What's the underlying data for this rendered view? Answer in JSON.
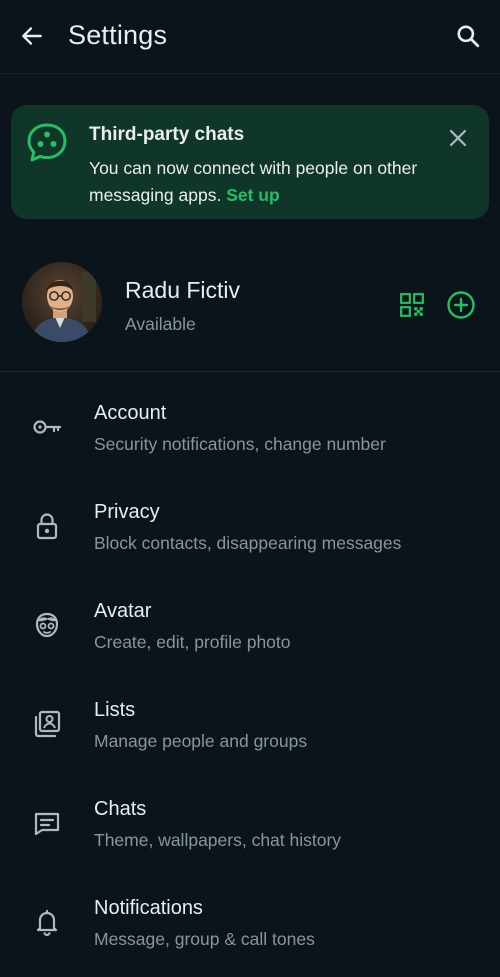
{
  "header": {
    "title": "Settings",
    "back_icon": "arrow-left-icon",
    "search_icon": "search-icon"
  },
  "banner": {
    "title": "Third-party chats",
    "text": "You can now connect with people on other messaging apps.",
    "link": "Set up",
    "icon": "chat-bubble-icon",
    "close_icon": "close-icon"
  },
  "profile": {
    "name": "Radu Fictiv",
    "status": "Available",
    "qr_icon": "qr-code-icon",
    "add_icon": "add-circle-icon"
  },
  "settings": {
    "items": [
      {
        "title": "Account",
        "subtitle": "Security notifications, change number",
        "icon": "key-icon"
      },
      {
        "title": "Privacy",
        "subtitle": "Block contacts, disappearing messages",
        "icon": "lock-icon"
      },
      {
        "title": "Avatar",
        "subtitle": "Create, edit, profile photo",
        "icon": "avatar-face-icon"
      },
      {
        "title": "Lists",
        "subtitle": "Manage people and groups",
        "icon": "contacts-list-icon"
      },
      {
        "title": "Chats",
        "subtitle": "Theme, wallpapers, chat history",
        "icon": "chat-message-icon"
      },
      {
        "title": "Notifications",
        "subtitle": "Message, group & call tones",
        "icon": "bell-icon"
      }
    ]
  },
  "colors": {
    "background": "#0b141a",
    "accent": "#21c063",
    "banner_bg": "#103529",
    "primary_text": "#e9edef",
    "secondary_text": "#8696a0",
    "icon": "#aebac1"
  }
}
